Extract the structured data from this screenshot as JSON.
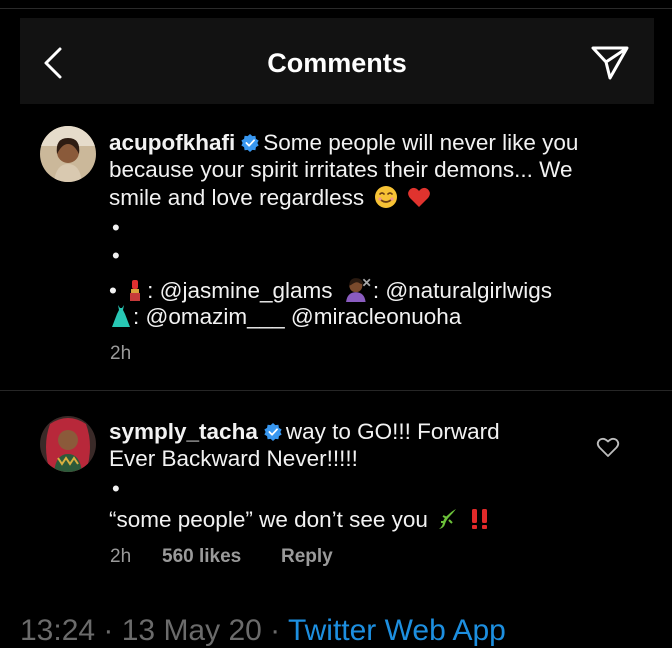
{
  "header": {
    "title": "Comments"
  },
  "post": {
    "username": "acupofkhafi",
    "caption_line1": "Some people will never like you",
    "caption_line2": "because your spirit irritates their demons... We",
    "caption_line3": "smile and love regardless",
    "credit_lipstick": ": @jasmine_glams",
    "credit_wig": ": @naturalgirlwigs",
    "credit_dress": ": @omazim___ @miracleonuoha",
    "time": "2h"
  },
  "comment": {
    "username": "symply_tacha",
    "text_line1": "way to GO!!! Forward",
    "text_line2": "Ever Backward Never!!!!!",
    "text_line3": "“some people” we don’t see you",
    "time": "2h",
    "likes": "560 likes",
    "reply_label": "Reply"
  },
  "footer": {
    "timestamp": "13:24 · 13 May 20 · ",
    "source": "Twitter Web App"
  },
  "colors": {
    "verified": "#3897f0",
    "link": "#1d8fe0",
    "background": "#000000"
  },
  "icons": [
    "back-arrow-icon",
    "send-icon",
    "verified-badge-icon",
    "smile-emoji",
    "heart-emoji",
    "lipstick-emoji",
    "woman-getting-haircut-emoji",
    "dress-emoji",
    "lizard-emoji",
    "double-exclamation-emoji",
    "heart-outline-icon"
  ]
}
